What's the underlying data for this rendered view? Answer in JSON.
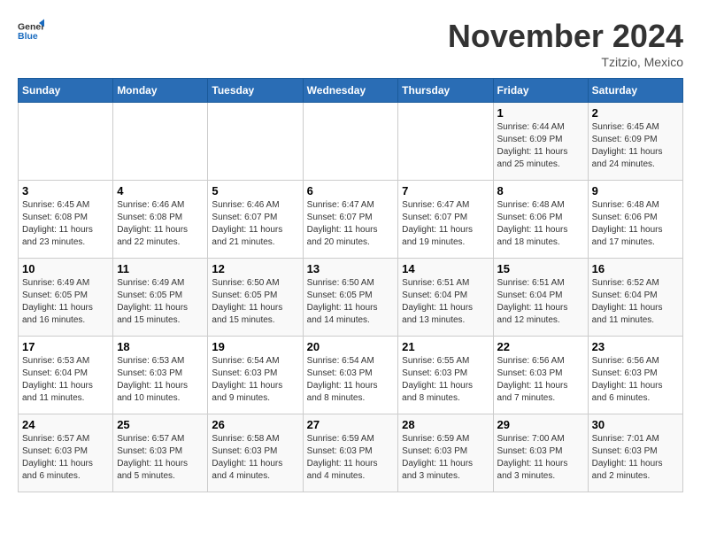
{
  "logo": {
    "general": "General",
    "blue": "Blue"
  },
  "header": {
    "month": "November 2024",
    "location": "Tzitzio, Mexico"
  },
  "weekdays": [
    "Sunday",
    "Monday",
    "Tuesday",
    "Wednesday",
    "Thursday",
    "Friday",
    "Saturday"
  ],
  "weeks": [
    [
      {
        "day": "",
        "info": ""
      },
      {
        "day": "",
        "info": ""
      },
      {
        "day": "",
        "info": ""
      },
      {
        "day": "",
        "info": ""
      },
      {
        "day": "",
        "info": ""
      },
      {
        "day": "1",
        "info": "Sunrise: 6:44 AM\nSunset: 6:09 PM\nDaylight: 11 hours and 25 minutes."
      },
      {
        "day": "2",
        "info": "Sunrise: 6:45 AM\nSunset: 6:09 PM\nDaylight: 11 hours and 24 minutes."
      }
    ],
    [
      {
        "day": "3",
        "info": "Sunrise: 6:45 AM\nSunset: 6:08 PM\nDaylight: 11 hours and 23 minutes."
      },
      {
        "day": "4",
        "info": "Sunrise: 6:46 AM\nSunset: 6:08 PM\nDaylight: 11 hours and 22 minutes."
      },
      {
        "day": "5",
        "info": "Sunrise: 6:46 AM\nSunset: 6:07 PM\nDaylight: 11 hours and 21 minutes."
      },
      {
        "day": "6",
        "info": "Sunrise: 6:47 AM\nSunset: 6:07 PM\nDaylight: 11 hours and 20 minutes."
      },
      {
        "day": "7",
        "info": "Sunrise: 6:47 AM\nSunset: 6:07 PM\nDaylight: 11 hours and 19 minutes."
      },
      {
        "day": "8",
        "info": "Sunrise: 6:48 AM\nSunset: 6:06 PM\nDaylight: 11 hours and 18 minutes."
      },
      {
        "day": "9",
        "info": "Sunrise: 6:48 AM\nSunset: 6:06 PM\nDaylight: 11 hours and 17 minutes."
      }
    ],
    [
      {
        "day": "10",
        "info": "Sunrise: 6:49 AM\nSunset: 6:05 PM\nDaylight: 11 hours and 16 minutes."
      },
      {
        "day": "11",
        "info": "Sunrise: 6:49 AM\nSunset: 6:05 PM\nDaylight: 11 hours and 15 minutes."
      },
      {
        "day": "12",
        "info": "Sunrise: 6:50 AM\nSunset: 6:05 PM\nDaylight: 11 hours and 15 minutes."
      },
      {
        "day": "13",
        "info": "Sunrise: 6:50 AM\nSunset: 6:05 PM\nDaylight: 11 hours and 14 minutes."
      },
      {
        "day": "14",
        "info": "Sunrise: 6:51 AM\nSunset: 6:04 PM\nDaylight: 11 hours and 13 minutes."
      },
      {
        "day": "15",
        "info": "Sunrise: 6:51 AM\nSunset: 6:04 PM\nDaylight: 11 hours and 12 minutes."
      },
      {
        "day": "16",
        "info": "Sunrise: 6:52 AM\nSunset: 6:04 PM\nDaylight: 11 hours and 11 minutes."
      }
    ],
    [
      {
        "day": "17",
        "info": "Sunrise: 6:53 AM\nSunset: 6:04 PM\nDaylight: 11 hours and 11 minutes."
      },
      {
        "day": "18",
        "info": "Sunrise: 6:53 AM\nSunset: 6:03 PM\nDaylight: 11 hours and 10 minutes."
      },
      {
        "day": "19",
        "info": "Sunrise: 6:54 AM\nSunset: 6:03 PM\nDaylight: 11 hours and 9 minutes."
      },
      {
        "day": "20",
        "info": "Sunrise: 6:54 AM\nSunset: 6:03 PM\nDaylight: 11 hours and 8 minutes."
      },
      {
        "day": "21",
        "info": "Sunrise: 6:55 AM\nSunset: 6:03 PM\nDaylight: 11 hours and 8 minutes."
      },
      {
        "day": "22",
        "info": "Sunrise: 6:56 AM\nSunset: 6:03 PM\nDaylight: 11 hours and 7 minutes."
      },
      {
        "day": "23",
        "info": "Sunrise: 6:56 AM\nSunset: 6:03 PM\nDaylight: 11 hours and 6 minutes."
      }
    ],
    [
      {
        "day": "24",
        "info": "Sunrise: 6:57 AM\nSunset: 6:03 PM\nDaylight: 11 hours and 6 minutes."
      },
      {
        "day": "25",
        "info": "Sunrise: 6:57 AM\nSunset: 6:03 PM\nDaylight: 11 hours and 5 minutes."
      },
      {
        "day": "26",
        "info": "Sunrise: 6:58 AM\nSunset: 6:03 PM\nDaylight: 11 hours and 4 minutes."
      },
      {
        "day": "27",
        "info": "Sunrise: 6:59 AM\nSunset: 6:03 PM\nDaylight: 11 hours and 4 minutes."
      },
      {
        "day": "28",
        "info": "Sunrise: 6:59 AM\nSunset: 6:03 PM\nDaylight: 11 hours and 3 minutes."
      },
      {
        "day": "29",
        "info": "Sunrise: 7:00 AM\nSunset: 6:03 PM\nDaylight: 11 hours and 3 minutes."
      },
      {
        "day": "30",
        "info": "Sunrise: 7:01 AM\nSunset: 6:03 PM\nDaylight: 11 hours and 2 minutes."
      }
    ]
  ]
}
